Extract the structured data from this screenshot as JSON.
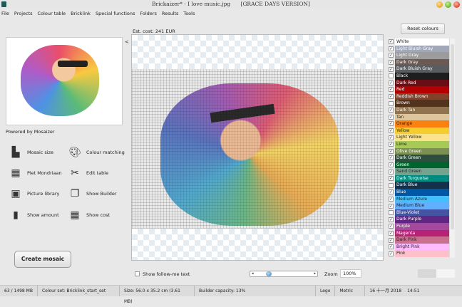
{
  "window": {
    "title": "Brickaizer* - I love music.jpg",
    "edition": "[GRACE DAYS VERSION]"
  },
  "menu": [
    "File",
    "Projects",
    "Colour table",
    "Bricklink",
    "Special functions",
    "Folders",
    "Results",
    "Tools"
  ],
  "left": {
    "collapse_arrow": "<",
    "powered_by": "Powered by Mosaizer",
    "tools": [
      {
        "label": "Mosaic size",
        "icon": "ruler-icon"
      },
      {
        "label": "Colour matching",
        "icon": "palette-icon"
      },
      {
        "label": "Piet Mondriaan",
        "icon": "grid-icon"
      },
      {
        "label": "Edit table",
        "icon": "scissors-icon"
      },
      {
        "label": "Picture library",
        "icon": "picture-icon"
      },
      {
        "label": "Show Builder",
        "icon": "documents-icon"
      },
      {
        "label": "Show amount",
        "icon": "bar-chart-icon"
      },
      {
        "label": "Show cost",
        "icon": "calculator-icon"
      }
    ],
    "create_button": "Create mosaic"
  },
  "main": {
    "est_cost": "Est. cost: 241 EUR",
    "show_follow_me": "Show follow-me text",
    "zoom_label": "Zoom",
    "zoom_value": "100%",
    "zoom_slider": 0.2
  },
  "colours": {
    "reset_button": "Reset colours",
    "items": [
      {
        "name": "White",
        "color": "#ffffff",
        "text": "#222",
        "checked": true
      },
      {
        "name": "Light Bluish Gray",
        "color": "#a3a8b8",
        "text": "#fff",
        "checked": true
      },
      {
        "name": "Light Gray",
        "color": "#9c9c9c",
        "text": "#fff",
        "checked": true
      },
      {
        "name": "Dark Gray",
        "color": "#6b5a54",
        "text": "#fff",
        "checked": true
      },
      {
        "name": "Dark Bluish Gray",
        "color": "#595d60",
        "text": "#fff",
        "checked": true
      },
      {
        "name": "Black",
        "color": "#1e1e1e",
        "text": "#fff",
        "checked": false
      },
      {
        "name": "Dark Red",
        "color": "#6a0e15",
        "text": "#fff",
        "checked": true
      },
      {
        "name": "Red",
        "color": "#b40000",
        "text": "#fff",
        "checked": true
      },
      {
        "name": "Reddish Brown",
        "color": "#82422a",
        "text": "#fff",
        "checked": true
      },
      {
        "name": "Brown",
        "color": "#53331e",
        "text": "#fff",
        "checked": false
      },
      {
        "name": "Dark Tan",
        "color": "#907450",
        "text": "#fff",
        "checked": true
      },
      {
        "name": "Tan",
        "color": "#dec69c",
        "text": "#222",
        "checked": true
      },
      {
        "name": "Orange",
        "color": "#fa8010",
        "text": "#222",
        "checked": true
      },
      {
        "name": "Yellow",
        "color": "#f5cd2f",
        "text": "#222",
        "checked": true
      },
      {
        "name": "Light Yellow",
        "color": "#fae38c",
        "text": "#222",
        "checked": true
      },
      {
        "name": "Lime",
        "color": "#a6ca55",
        "text": "#222",
        "checked": true
      },
      {
        "name": "Olive Green",
        "color": "#7c9051",
        "text": "#fff",
        "checked": true
      },
      {
        "name": "Dark Green",
        "color": "#2e4f3e",
        "text": "#fff",
        "checked": true
      },
      {
        "name": "Green",
        "color": "#00642e",
        "text": "#fff",
        "checked": true
      },
      {
        "name": "Sand Green",
        "color": "#76a290",
        "text": "#222",
        "checked": true
      },
      {
        "name": "Dark Turquoise",
        "color": "#008a80",
        "text": "#fff",
        "checked": true
      },
      {
        "name": "Dark Blue",
        "color": "#14304a",
        "text": "#fff",
        "checked": false
      },
      {
        "name": "Blue",
        "color": "#0057a6",
        "text": "#fff",
        "checked": true
      },
      {
        "name": "Medium Azure",
        "color": "#42c0fb",
        "text": "#222",
        "checked": true
      },
      {
        "name": "Medium Blue",
        "color": "#61afff",
        "text": "#222",
        "checked": true
      },
      {
        "name": "Blue-Violet",
        "color": "#4354a3",
        "text": "#fff",
        "checked": false
      },
      {
        "name": "Dark Purple",
        "color": "#5f2683",
        "text": "#fff",
        "checked": true
      },
      {
        "name": "Purple",
        "color": "#a5499c",
        "text": "#fff",
        "checked": true
      },
      {
        "name": "Magenta",
        "color": "#b72276",
        "text": "#fff",
        "checked": true
      },
      {
        "name": "Dark Pink",
        "color": "#c8708e",
        "text": "#222",
        "checked": true
      },
      {
        "name": "Bright Pink",
        "color": "#ffbbff",
        "text": "#222",
        "checked": true
      },
      {
        "name": "Pink",
        "color": "#ffc0cb",
        "text": "#222",
        "checked": true
      }
    ]
  },
  "status": {
    "memory": "63 / 1498 MB",
    "colour_set": "Colour set: Bricklink_start_set",
    "size": "Size: 56.0 x 35.2 cm (3.61 MB)",
    "capacity": "Builder capacity: 13%",
    "brand": "Lego",
    "units": "Metric",
    "date": "16 十一月 2018",
    "time": "14:51"
  }
}
